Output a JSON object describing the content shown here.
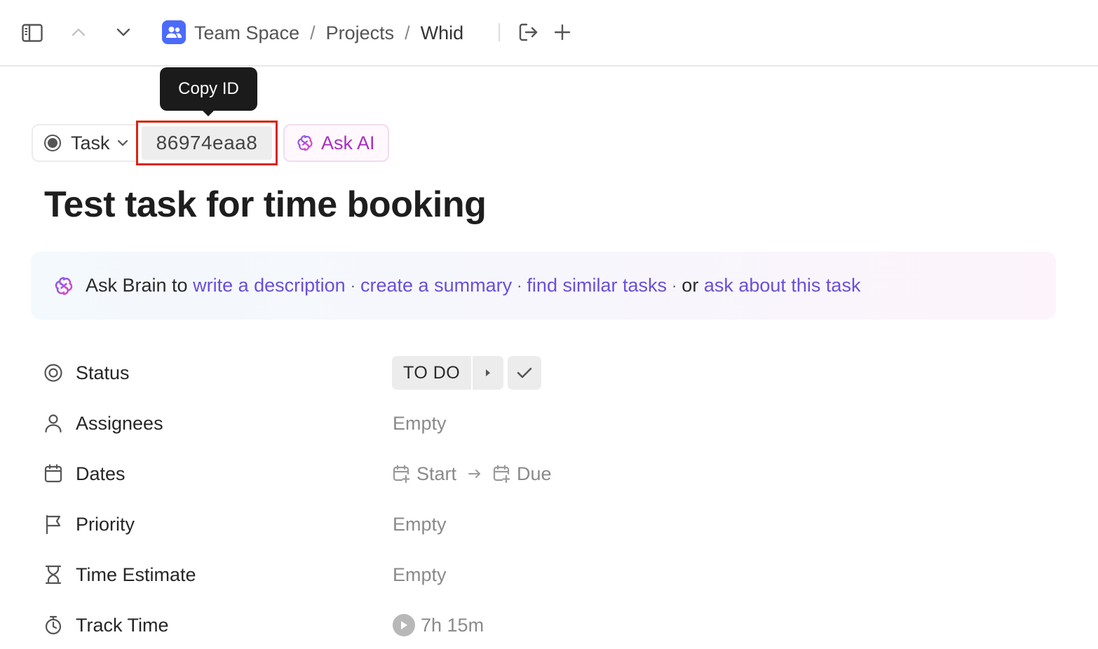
{
  "breadcrumb": {
    "items": [
      "Team Space",
      "Projects",
      "Whid"
    ],
    "separator": "/"
  },
  "tooltip": {
    "text": "Copy ID"
  },
  "task_header": {
    "type_label": "Task",
    "task_id": "86974eaa8",
    "ask_ai_label": "Ask AI",
    "title": "Test task for time booking"
  },
  "brain_banner": {
    "prefix": "Ask Brain to",
    "link1": "write a description",
    "link2": "create a summary",
    "link3": "find similar tasks",
    "joiner": "or",
    "link4": "ask about this task",
    "dot": "·"
  },
  "properties": {
    "status": {
      "label": "Status",
      "value": "TO DO"
    },
    "assignees": {
      "label": "Assignees",
      "value": "Empty"
    },
    "dates": {
      "label": "Dates",
      "start": "Start",
      "due": "Due"
    },
    "priority": {
      "label": "Priority",
      "value": "Empty"
    },
    "time_estimate": {
      "label": "Time Estimate",
      "value": "Empty"
    },
    "track_time": {
      "label": "Track Time",
      "value": "7h 15m"
    }
  },
  "colors": {
    "accent_blue": "#4b6bfb",
    "highlight_red": "#d8270e",
    "ai_purple": "#a82fc0",
    "link_purple": "#6a4fd8"
  },
  "icons": {
    "sidebar": "sidebar-toggle-icon",
    "up": "chevron-up-icon",
    "down": "chevron-down-icon",
    "space": "people-icon",
    "export": "export-icon",
    "plus": "plus-icon"
  }
}
